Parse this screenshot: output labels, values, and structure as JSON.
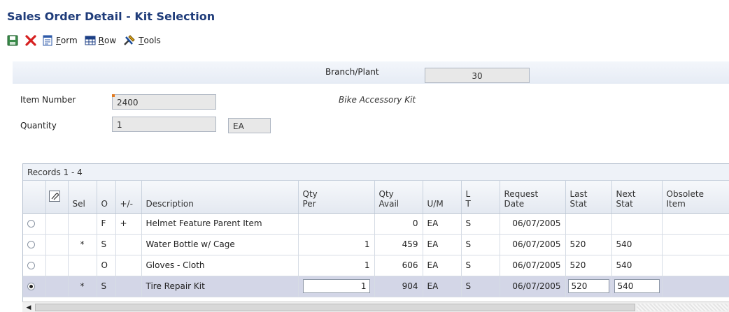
{
  "window": {
    "title": "Sales Order Detail - Kit Selection"
  },
  "toolbar": {
    "save_icon": "save-icon",
    "close_icon": "close-icon",
    "form": {
      "accel": "F",
      "rest": "orm"
    },
    "row": {
      "accel": "R",
      "rest": "ow"
    },
    "tools": {
      "accel": "T",
      "rest": "ools"
    }
  },
  "header": {
    "branch_plant_label": "Branch/Plant",
    "branch_plant_value": "30",
    "item_number_label": "Item Number",
    "item_number_value": "2400",
    "item_description": "Bike Accessory Kit",
    "quantity_label": "Quantity",
    "quantity_value": "1",
    "uom_value": "EA"
  },
  "grid": {
    "records_label": "Records 1 - 4",
    "columns": {
      "sel": "Sel",
      "o": "O",
      "plusminus": "+/-",
      "description": "Description",
      "qty_per_1": "Qty",
      "qty_per_2": "Per",
      "qty_avail_1": "Qty",
      "qty_avail_2": "Avail",
      "um": "U/M",
      "lt_1": "L",
      "lt_2": "T",
      "req_date_1": "Request",
      "req_date_2": "Date",
      "last_stat_1": "Last",
      "last_stat_2": "Stat",
      "next_stat_1": "Next",
      "next_stat_2": "Stat",
      "obsolete_1": "Obsolete",
      "obsolete_2": "Item"
    },
    "rows": [
      {
        "selected": false,
        "sel": "",
        "o": "F",
        "pm": "+",
        "description": "Helmet Feature Parent Item",
        "qty_per": "",
        "qty_avail": "0",
        "um": "EA",
        "lt": "S",
        "req_date": "06/07/2005",
        "last_stat": "",
        "next_stat": "",
        "obsolete": ""
      },
      {
        "selected": false,
        "sel": "*",
        "o": "S",
        "pm": "",
        "description": "Water Bottle w/ Cage",
        "qty_per": "1",
        "qty_avail": "459",
        "um": "EA",
        "lt": "S",
        "req_date": "06/07/2005",
        "last_stat": "520",
        "next_stat": "540",
        "obsolete": ""
      },
      {
        "selected": false,
        "sel": "",
        "o": "O",
        "pm": "",
        "description": "Gloves - Cloth",
        "qty_per": "1",
        "qty_avail": "606",
        "um": "EA",
        "lt": "S",
        "req_date": "06/07/2005",
        "last_stat": "520",
        "next_stat": "540",
        "obsolete": ""
      },
      {
        "selected": true,
        "sel": "*",
        "o": "S",
        "pm": "",
        "description": "Tire Repair Kit",
        "qty_per": "1",
        "qty_avail": "904",
        "um": "EA",
        "lt": "S",
        "req_date": "06/07/2005",
        "last_stat": "520",
        "next_stat": "540",
        "obsolete": ""
      }
    ]
  }
}
